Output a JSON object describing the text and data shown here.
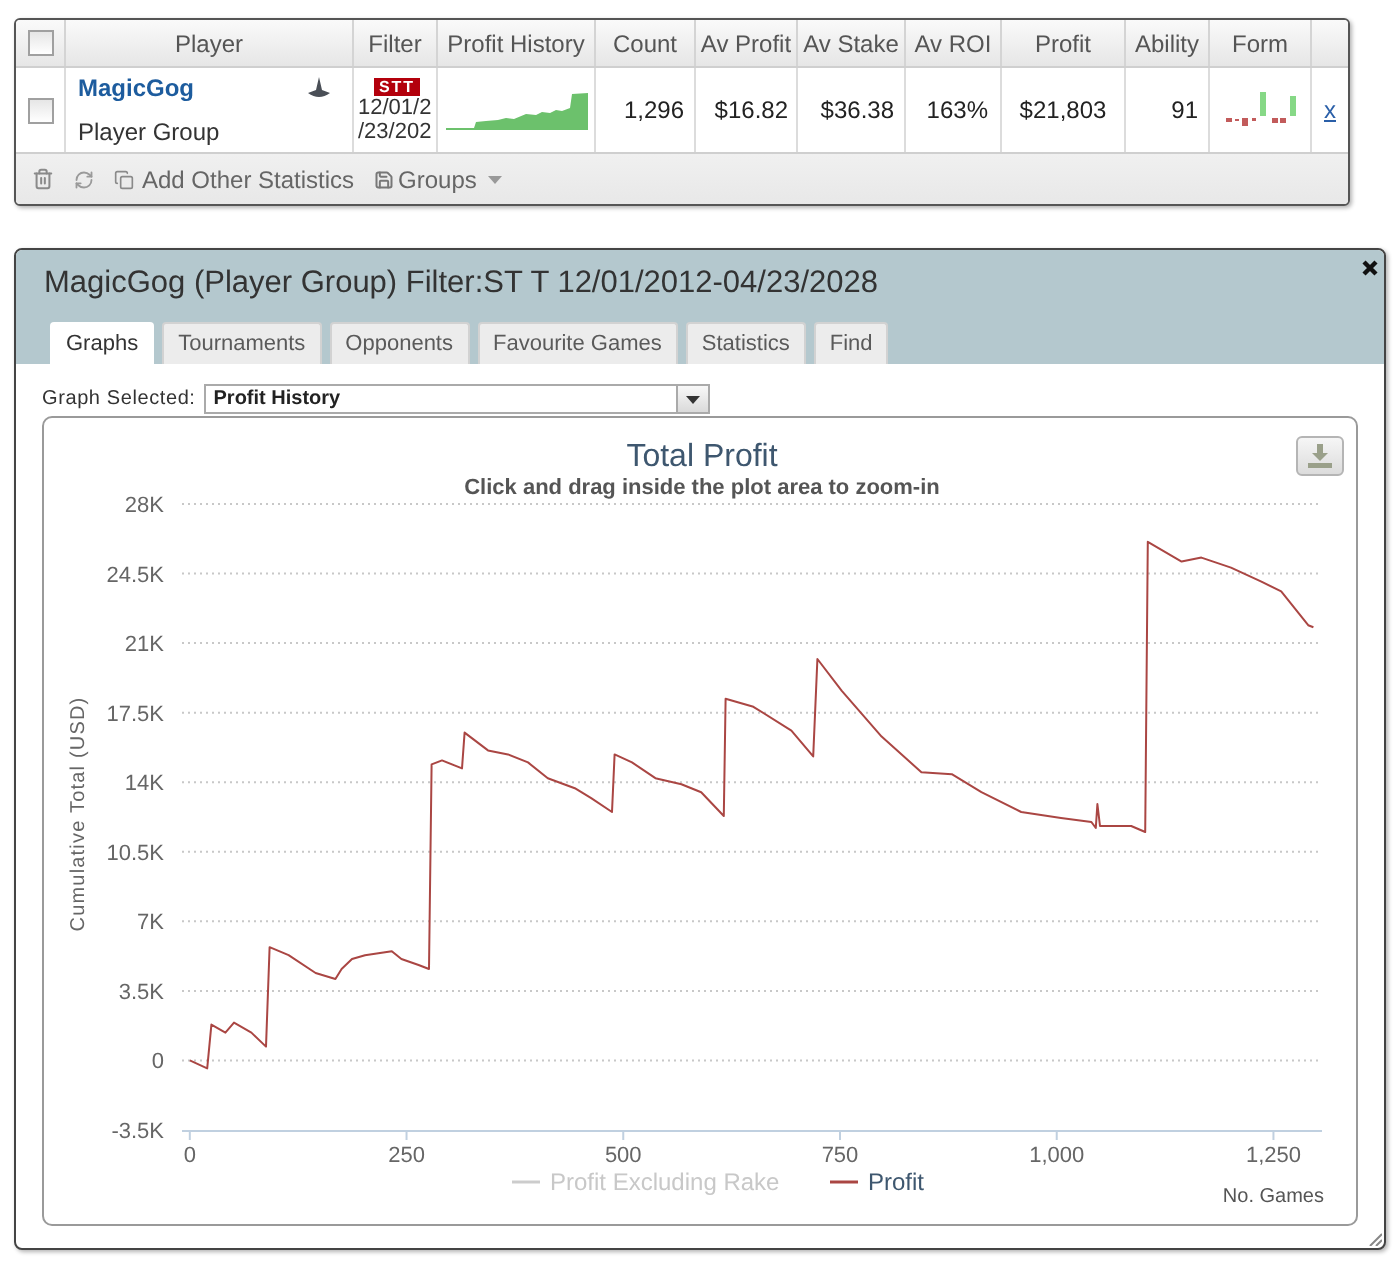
{
  "stats_table": {
    "select_all": {
      "checked": false
    },
    "columns": [
      "Player",
      "Filter",
      "Profit History",
      "Count",
      "Av Profit",
      "Av Stake",
      "Av ROI",
      "Profit",
      "Ability",
      "Form"
    ],
    "rows": [
      {
        "checked": false,
        "player": "MagicGog",
        "player_type": "Player Group",
        "filter_badge": "STT",
        "filter_dates": [
          "12/01/2",
          "/23/202"
        ],
        "count": "1,296",
        "av_profit": "$16.82",
        "av_stake": "$36.38",
        "av_roi": "163%",
        "profit": "$21,803",
        "ability": "91",
        "remove": "x"
      }
    ],
    "toolbar": {
      "add_statistics": "Add Other Statistics",
      "groups": "Groups"
    }
  },
  "panel": {
    "title": "MagicGog (Player Group) Filter:ST T 12/01/2012-04/23/2028",
    "tabs": [
      {
        "label": "Graphs",
        "selected": true
      },
      {
        "label": "Tournaments",
        "selected": false
      },
      {
        "label": "Opponents",
        "selected": false
      },
      {
        "label": "Favourite Games",
        "selected": false
      },
      {
        "label": "Statistics",
        "selected": false
      },
      {
        "label": "Find",
        "selected": false
      }
    ],
    "graph_select": {
      "label": "Graph Selected:",
      "value": "Profit History"
    },
    "chart": {
      "subtitle": "Click and drag inside the plot area to zoom-in",
      "hidden_legend": [
        {
          "label": "Profit Excluding Rake",
          "enabled": false
        }
      ],
      "chart_data": {
        "type": "line",
        "title": "Total Profit",
        "xlabel": "No. Games",
        "ylabel": "Cumulative Total (USD)",
        "grid": true,
        "x": [
          0,
          20,
          25,
          41,
          51,
          71,
          88,
          92,
          114,
          145,
          168,
          175,
          187,
          202,
          233,
          244,
          264,
          276,
          279,
          291,
          314,
          317,
          344,
          367,
          390,
          413,
          444,
          463,
          487,
          490,
          510,
          537,
          567,
          590,
          616,
          618,
          650,
          694,
          719,
          724,
          752,
          798,
          844,
          879,
          913,
          959,
          1005,
          1040,
          1045,
          1047,
          1050,
          1086,
          1102,
          1105,
          1144,
          1167,
          1201,
          1236,
          1259,
          1290,
          1296
        ],
        "series": [
          {
            "name": "Profit",
            "color": "#aa4643",
            "values": [
              0,
              -400,
              1800,
              1400,
              1900,
              1400,
              700,
              5700,
              5300,
              4400,
              4100,
              4600,
              5100,
              5300,
              5500,
              5100,
              4800,
              4600,
              14900,
              15100,
              14700,
              16500,
              15600,
              15400,
              15000,
              14200,
              13700,
              13200,
              12500,
              15400,
              15000,
              14200,
              13900,
              13500,
              12300,
              18200,
              17800,
              16600,
              15300,
              20200,
              18600,
              16300,
              14500,
              14400,
              13500,
              12500,
              12200,
              12000,
              11700,
              12900,
              11800,
              11800,
              11500,
              26100,
              25100,
              25300,
              24800,
              24100,
              23600,
              21900,
              21800
            ]
          }
        ],
        "xlim": [
          -9,
          1306
        ],
        "ylim": [
          -3500,
          28000
        ],
        "xticks": [
          0,
          250,
          500,
          750,
          {
            "value": 1000,
            "label": "1,000"
          },
          {
            "value": 1250,
            "label": "1,250"
          }
        ],
        "yticks": [
          {
            "value": -3500,
            "label": "-3.5K"
          },
          {
            "value": 0,
            "label": "0"
          },
          {
            "value": 3500,
            "label": "3.5K"
          },
          {
            "value": 7000,
            "label": "7K"
          },
          {
            "value": 10500,
            "label": "10.5K"
          },
          {
            "value": 14000,
            "label": "14K"
          },
          {
            "value": 17500,
            "label": "17.5K"
          },
          {
            "value": 21000,
            "label": "21K"
          },
          {
            "value": 24500,
            "label": "24.5K"
          },
          {
            "value": 28000,
            "label": "28K"
          }
        ]
      }
    }
  }
}
